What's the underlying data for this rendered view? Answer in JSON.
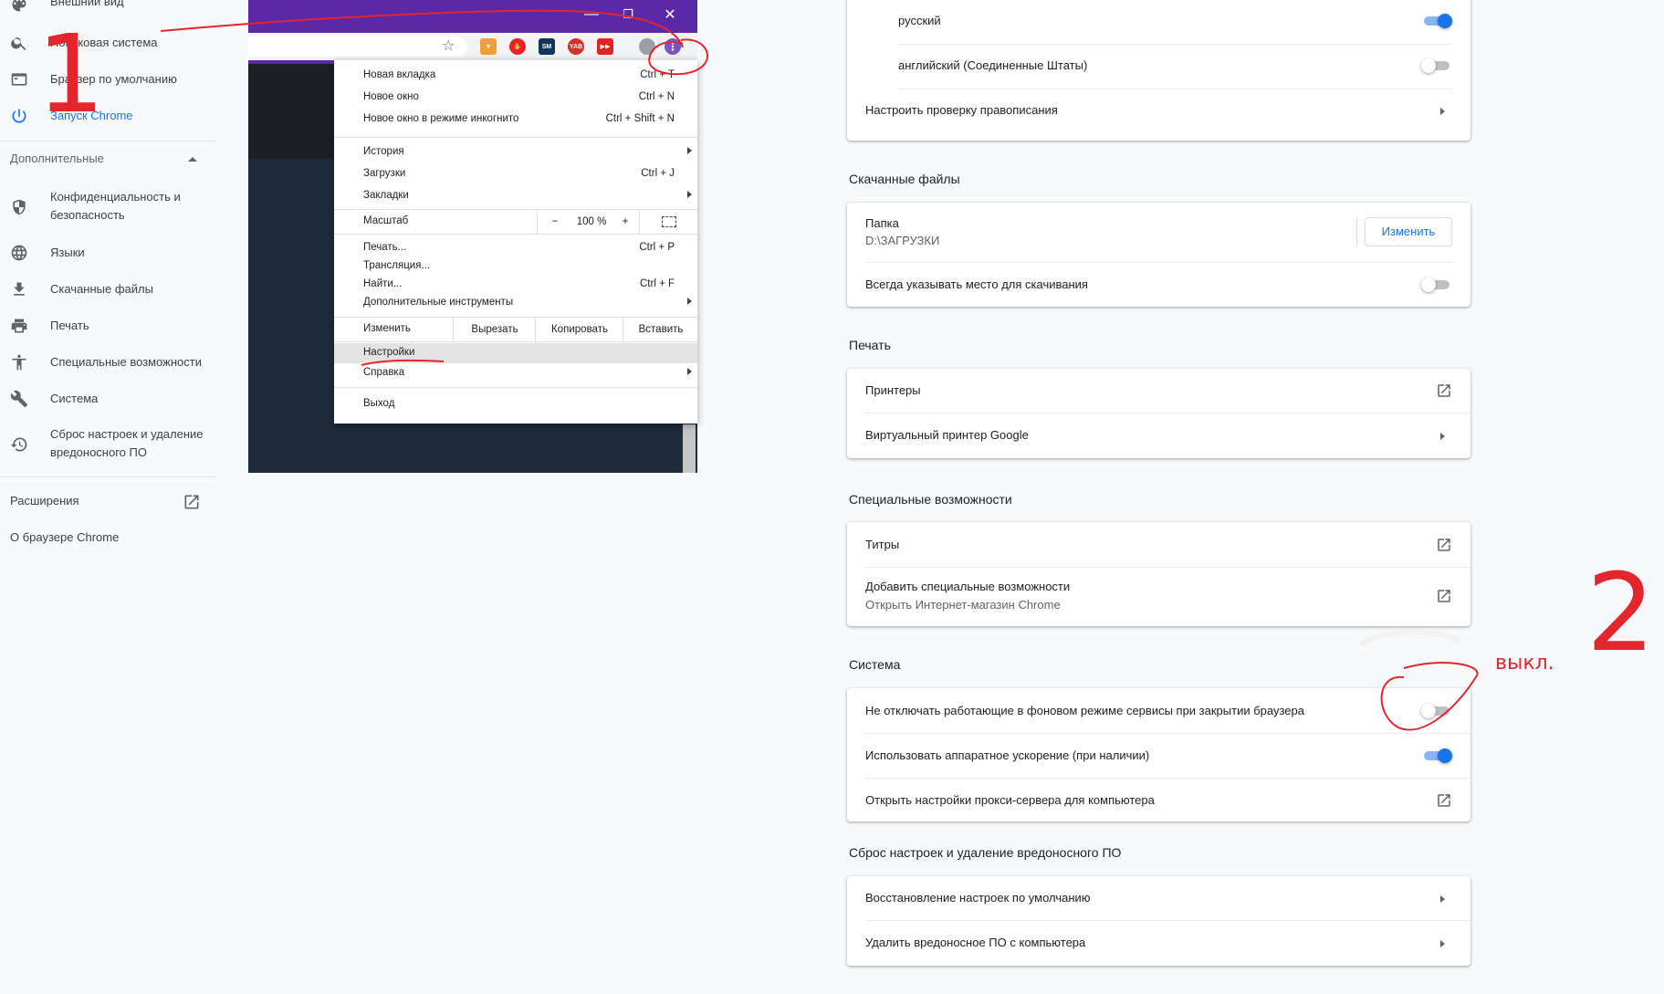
{
  "sidebar": {
    "items": [
      {
        "label": "Внешний вид",
        "icon": "palette-icon"
      },
      {
        "label": "Поисковая система",
        "icon": "search-icon"
      },
      {
        "label": "Браузер по умолчанию",
        "icon": "browser-icon"
      },
      {
        "label": "Запуск Chrome",
        "icon": "power-icon"
      }
    ],
    "advanced_label": "Дополнительные",
    "advanced_items": [
      {
        "label": "Конфиденциальность и безопасность",
        "icon": "shield-icon"
      },
      {
        "label": "Языки",
        "icon": "globe-icon"
      },
      {
        "label": "Скачанные файлы",
        "icon": "download-icon"
      },
      {
        "label": "Печать",
        "icon": "print-icon"
      },
      {
        "label": "Специальные возможности",
        "icon": "accessibility-icon"
      },
      {
        "label": "Система",
        "icon": "wrench-icon"
      },
      {
        "label": "Сброс настроек и удаление вредоносного ПО",
        "icon": "restore-icon"
      }
    ],
    "extensions_label": "Расширения",
    "about_label": "О браузере Chrome"
  },
  "chrome_menu": {
    "new_tab": "Новая вкладка",
    "new_tab_key": "Ctrl + T",
    "new_window": "Новое окно",
    "new_window_key": "Ctrl + N",
    "incognito": "Новое окно в режиме инкогнито",
    "incognito_key": "Ctrl + Shift + N",
    "history": "История",
    "downloads": "Загрузки",
    "downloads_key": "Ctrl + J",
    "bookmarks": "Закладки",
    "zoom_label": "Масштаб",
    "zoom_minus": "−",
    "zoom_value": "100 %",
    "zoom_plus": "+",
    "print": "Печать...",
    "print_key": "Ctrl + P",
    "cast": "Трансляция...",
    "find": "Найти...",
    "find_key": "Ctrl + F",
    "more_tools": "Дополнительные инструменты",
    "edit": "Изменить",
    "cut": "Вырезать",
    "copy": "Копировать",
    "paste": "Вставить",
    "settings": "Настройки",
    "help": "Справка",
    "exit": "Выход"
  },
  "languages": {
    "russian": "русский",
    "russian_on": true,
    "english": "английский (Соединенные Штаты)",
    "english_on": false,
    "spellcheck": "Настроить проверку правописания"
  },
  "downloads": {
    "title": "Скачанные файлы",
    "folder_label": "Папка",
    "folder_path": "D:\\ЗАГРУЗКИ",
    "change_button": "Изменить",
    "ask_location": "Всегда указывать место для скачивания",
    "ask_location_on": false
  },
  "printing": {
    "title": "Печать",
    "printers": "Принтеры",
    "cloud_print": "Виртуальный принтер Google"
  },
  "accessibility": {
    "title": "Специальные возможности",
    "captions": "Титры",
    "add_features": "Добавить специальные возможности",
    "add_features_sub": "Открыть Интернет-магазин Chrome"
  },
  "system": {
    "title": "Система",
    "background_apps": "Не отключать работающие в фоновом режиме сервисы при закрытии браузера",
    "background_apps_on": false,
    "hardware_accel": "Использовать аппаратное ускорение (при наличии)",
    "hardware_accel_on": true,
    "proxy": "Открыть настройки прокси-сервера для компьютера"
  },
  "reset": {
    "title": "Сброс настроек и удаление вредоносного ПО",
    "restore": "Восстановление настроек по умолчанию",
    "cleanup": "Удалить вредоносное ПО с компьютера"
  },
  "annotations": {
    "step1": "1",
    "step2": "2",
    "off_note": "выкл."
  },
  "colors": {
    "accent": "#1a73e8",
    "annotation": "#e3262d",
    "titlebar": "#5b28a8"
  }
}
